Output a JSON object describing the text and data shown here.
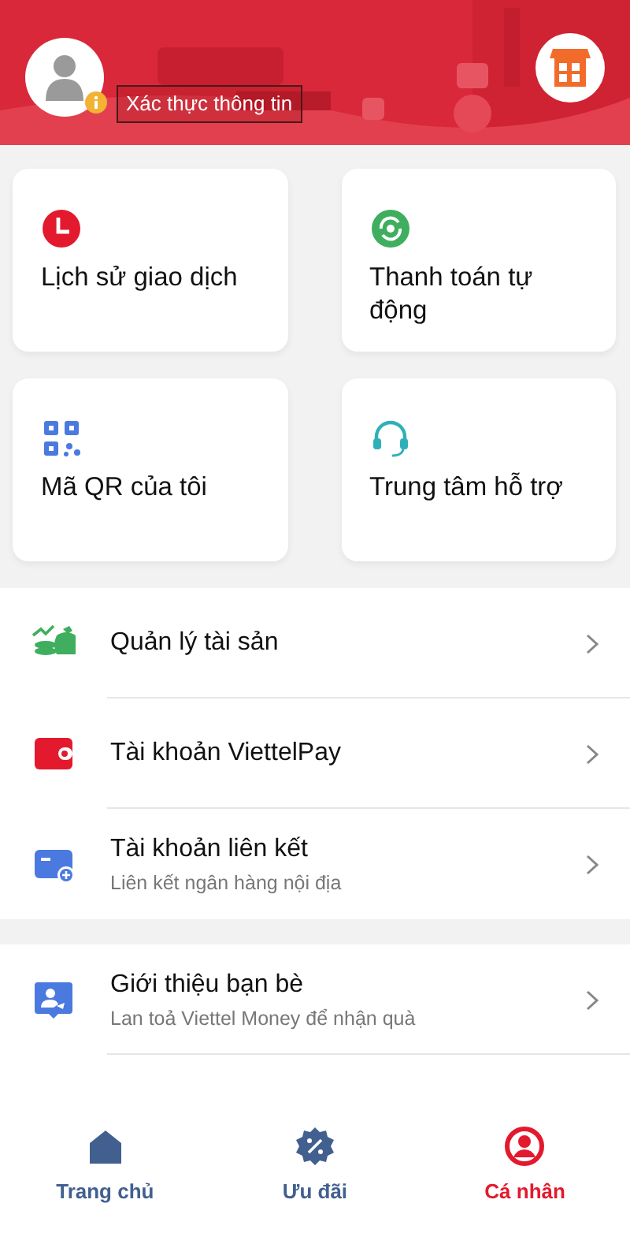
{
  "header": {
    "verify_label": "Xác thực thông tin"
  },
  "shortcuts": [
    {
      "label": "Lịch sử giao dịch"
    },
    {
      "label": "Thanh toán tự động"
    },
    {
      "label": "Mã QR của tôi"
    },
    {
      "label": "Trung tâm hỗ trợ"
    }
  ],
  "menu_groups": [
    {
      "items": [
        {
          "title": "Quản lý tài sản"
        },
        {
          "title": "Tài khoản ViettelPay"
        },
        {
          "title": "Tài khoản liên kết",
          "subtitle": "Liên kết ngân hàng nội địa"
        }
      ]
    },
    {
      "items": [
        {
          "title": "Giới thiệu bạn bè",
          "subtitle": "Lan toả Viettel Money để nhận quà"
        }
      ]
    }
  ],
  "bottom_nav": [
    {
      "label": "Trang chủ",
      "selected": false
    },
    {
      "label": "Ưu đãi",
      "selected": false
    },
    {
      "label": "Cá nhân",
      "selected": true
    }
  ]
}
